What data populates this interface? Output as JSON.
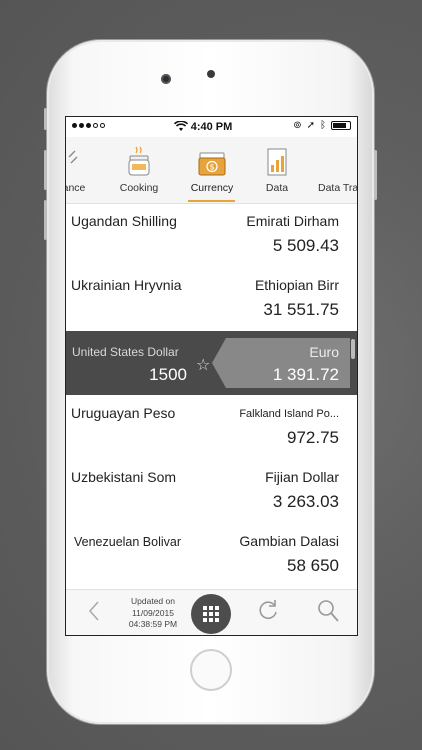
{
  "status_bar": {
    "time": "4:40 PM"
  },
  "tabs": [
    {
      "label": "ance",
      "icon": "partial-icon"
    },
    {
      "label": "Cooking",
      "icon": "cooking-pot-icon"
    },
    {
      "label": "Currency",
      "icon": "currency-cash-icon",
      "active": true
    },
    {
      "label": "Data",
      "icon": "data-document-icon"
    },
    {
      "label": "Data Tra",
      "icon": "data-transfer-icon"
    }
  ],
  "rows": [
    {
      "left": "Ugandan Shilling",
      "right": "Emirati Dirham",
      "value": "5 509.43"
    },
    {
      "left": "Ukrainian Hryvnia",
      "right": "Ethiopian Birr",
      "value": "31 551.75"
    },
    {
      "left": "United States Dollar",
      "left_value": "1500",
      "right": "Euro",
      "value": "1 391.72",
      "selected": true
    },
    {
      "left": "Uruguayan Peso",
      "right": "Falkland Island Po...",
      "value": "972.75"
    },
    {
      "left": "Uzbekistani Som",
      "right": "Fijian Dollar",
      "value": "3 263.03"
    },
    {
      "left": "Venezuelan Bolivar",
      "right": "Gambian Dalasi",
      "value": "58 650"
    }
  ],
  "bottom_bar": {
    "updated_label": "Updated on",
    "updated_date": "11/09/2015",
    "updated_time": "04:38:59 PM"
  },
  "colors": {
    "accent": "#e8a33a",
    "selected_row": "#4a4a4a"
  }
}
